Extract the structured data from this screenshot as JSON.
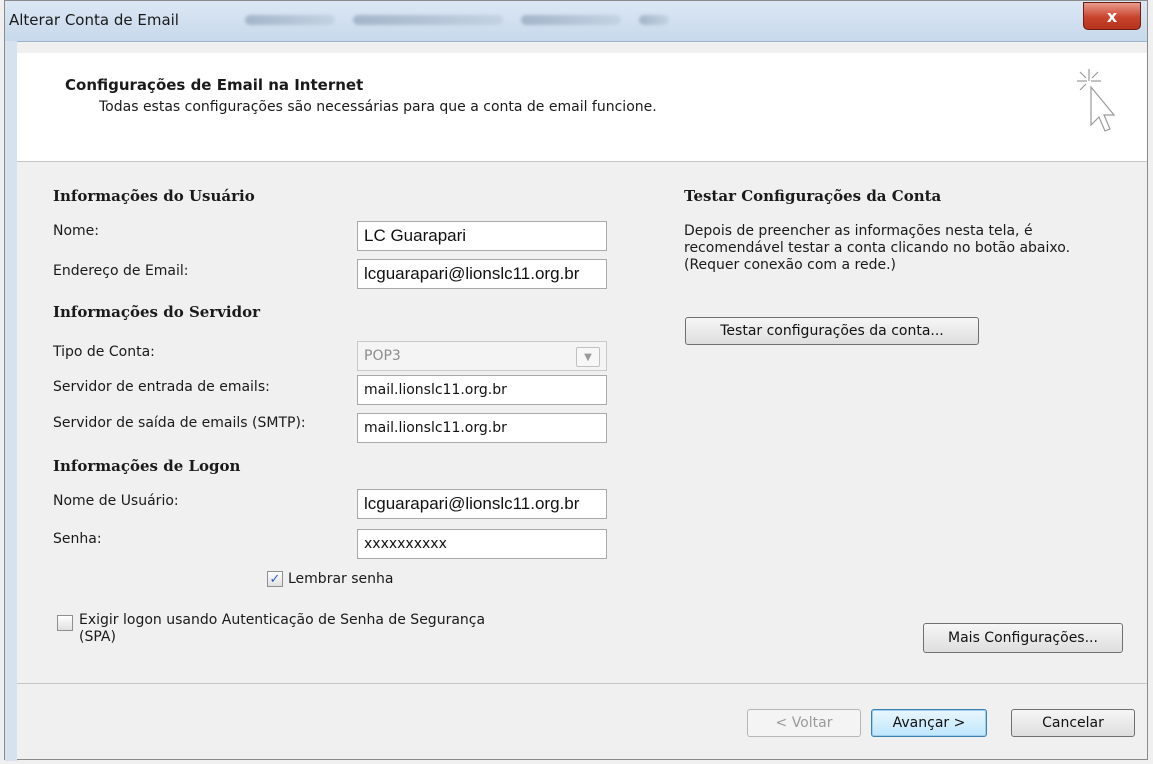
{
  "window": {
    "title": "Alterar Conta de Email",
    "close_label": "x"
  },
  "header": {
    "title": "Configurações de Email na Internet",
    "subtitle": "Todas estas configurações são necessárias para que a conta de email funcione."
  },
  "user_info": {
    "section_title": "Informações do Usuário",
    "name_label": "Nome:",
    "name_value": "LC Guarapari",
    "email_label": "Endereço de Email:",
    "email_value": "lcguarapari@lionslc11.org.br"
  },
  "server_info": {
    "section_title": "Informações do Servidor",
    "account_type_label": "Tipo de Conta:",
    "account_type_value": "POP3",
    "incoming_label": "Servidor de entrada de emails:",
    "incoming_value": "mail.lionslc11.org.br",
    "outgoing_label": "Servidor de saída de emails (SMTP):",
    "outgoing_value": "mail.lionslc11.org.br"
  },
  "logon_info": {
    "section_title": "Informações de Logon",
    "username_label": "Nome de Usuário:",
    "username_value": "lcguarapari@lionslc11.org.br",
    "password_label": "Senha:",
    "password_value": "xxxxxxxxxx",
    "remember_label": "Lembrar senha",
    "remember_checked": true,
    "spa_label_line1": "Exigir logon usando Autenticação de Senha de Segurança",
    "spa_label_line2": "(SPA)",
    "spa_checked": false
  },
  "test_settings": {
    "section_title": "Testar Configurações da Conta",
    "description_line1": "Depois de preencher as informações nesta tela, é",
    "description_line2": "recomendável testar a conta clicando no botão abaixo.",
    "description_line3": "(Requer conexão com a rede.)",
    "test_button": "Testar configurações da conta..."
  },
  "more_settings_button": "Mais Configurações...",
  "footer": {
    "back_button": "< Voltar",
    "next_button": "Avançar >",
    "cancel_button": "Cancelar"
  },
  "icons": [
    "cursor-sparkle-icon",
    "check-icon",
    "dropdown-arrow-icon",
    "close-icon"
  ],
  "colors": {
    "close_button": "#c8442d",
    "checkbox_check": "#2a62c5",
    "header_background": "#ffffff",
    "dialog_background": "#f0f0f0"
  }
}
